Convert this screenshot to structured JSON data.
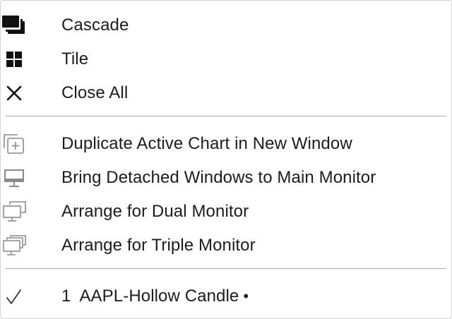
{
  "menu": {
    "items": [
      {
        "label": "Cascade",
        "icon": "cascade-icon"
      },
      {
        "label": "Tile",
        "icon": "tile-icon"
      },
      {
        "label": "Close All",
        "icon": "close-icon"
      },
      {
        "label": "Duplicate Active Chart in New Window",
        "icon": "duplicate-window-icon"
      },
      {
        "label": "Bring Detached Windows to Main Monitor",
        "icon": "monitor-icon"
      },
      {
        "label": "Arrange for Dual Monitor",
        "icon": "dual-monitor-icon"
      },
      {
        "label": "Arrange for Triple Monitor",
        "icon": "triple-monitor-icon"
      }
    ],
    "windows": [
      {
        "number": "1",
        "title": "AAPL-Hollow Candle",
        "indicator": "•",
        "checked": true,
        "icon": "checkmark-icon"
      }
    ]
  },
  "colors": {
    "text": "#1c1c1c",
    "separator": "#a8a8a8",
    "icon_dark": "#111111",
    "icon_gray": "#8a8a8a",
    "border": "#d4d4d4"
  }
}
